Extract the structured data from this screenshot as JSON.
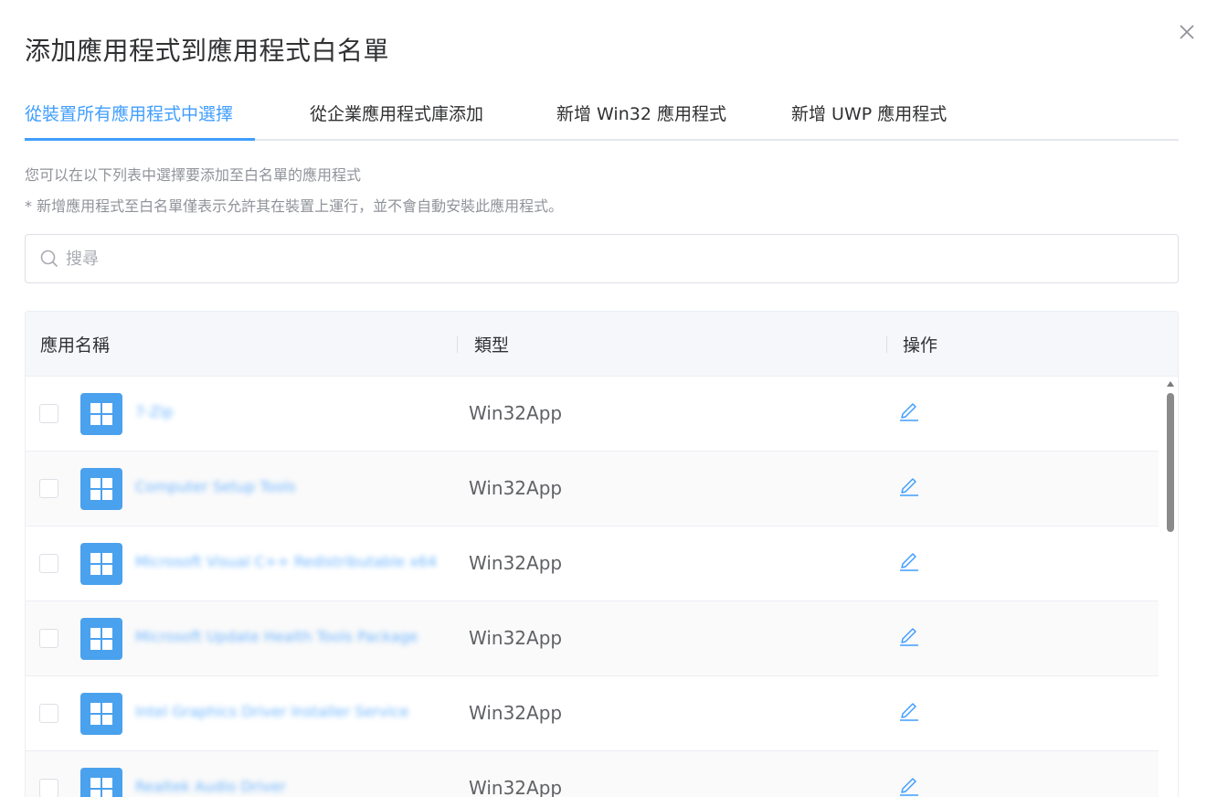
{
  "dialog": {
    "title": "添加應用程式到應用程式白名單"
  },
  "tabs": [
    {
      "label": "從裝置所有應用程式中選擇",
      "active": true
    },
    {
      "label": "從企業應用程式庫添加",
      "active": false
    },
    {
      "label": "新增 Win32 應用程式",
      "active": false
    },
    {
      "label": "新增 UWP 應用程式",
      "active": false
    }
  ],
  "hints": {
    "line1": "您可以在以下列表中選擇要添加至白名單的應用程式",
    "line2": "* 新增應用程式至白名單僅表示允許其在裝置上運行，並不會自動安裝此應用程式。"
  },
  "search": {
    "placeholder": "搜尋",
    "value": ""
  },
  "table": {
    "columns": [
      "應用名稱",
      "類型",
      "操作"
    ],
    "rows": [
      {
        "name": "7-Zip",
        "type": "Win32App"
      },
      {
        "name": "Computer Setup Tools",
        "type": "Win32App"
      },
      {
        "name": "Microsoft Visual C++ Redistributable x64",
        "type": "Win32App"
      },
      {
        "name": "Microsoft Update Health Tools Package",
        "type": "Win32App"
      },
      {
        "name": "Intel Graphics Driver Installer Service",
        "type": "Win32App"
      },
      {
        "name": "Realtek Audio Driver",
        "type": "Win32App"
      }
    ]
  },
  "colors": {
    "accent": "#409eff",
    "app_icon_bg": "#4aa1ee",
    "text_primary": "#303133",
    "text_secondary": "#909399"
  }
}
